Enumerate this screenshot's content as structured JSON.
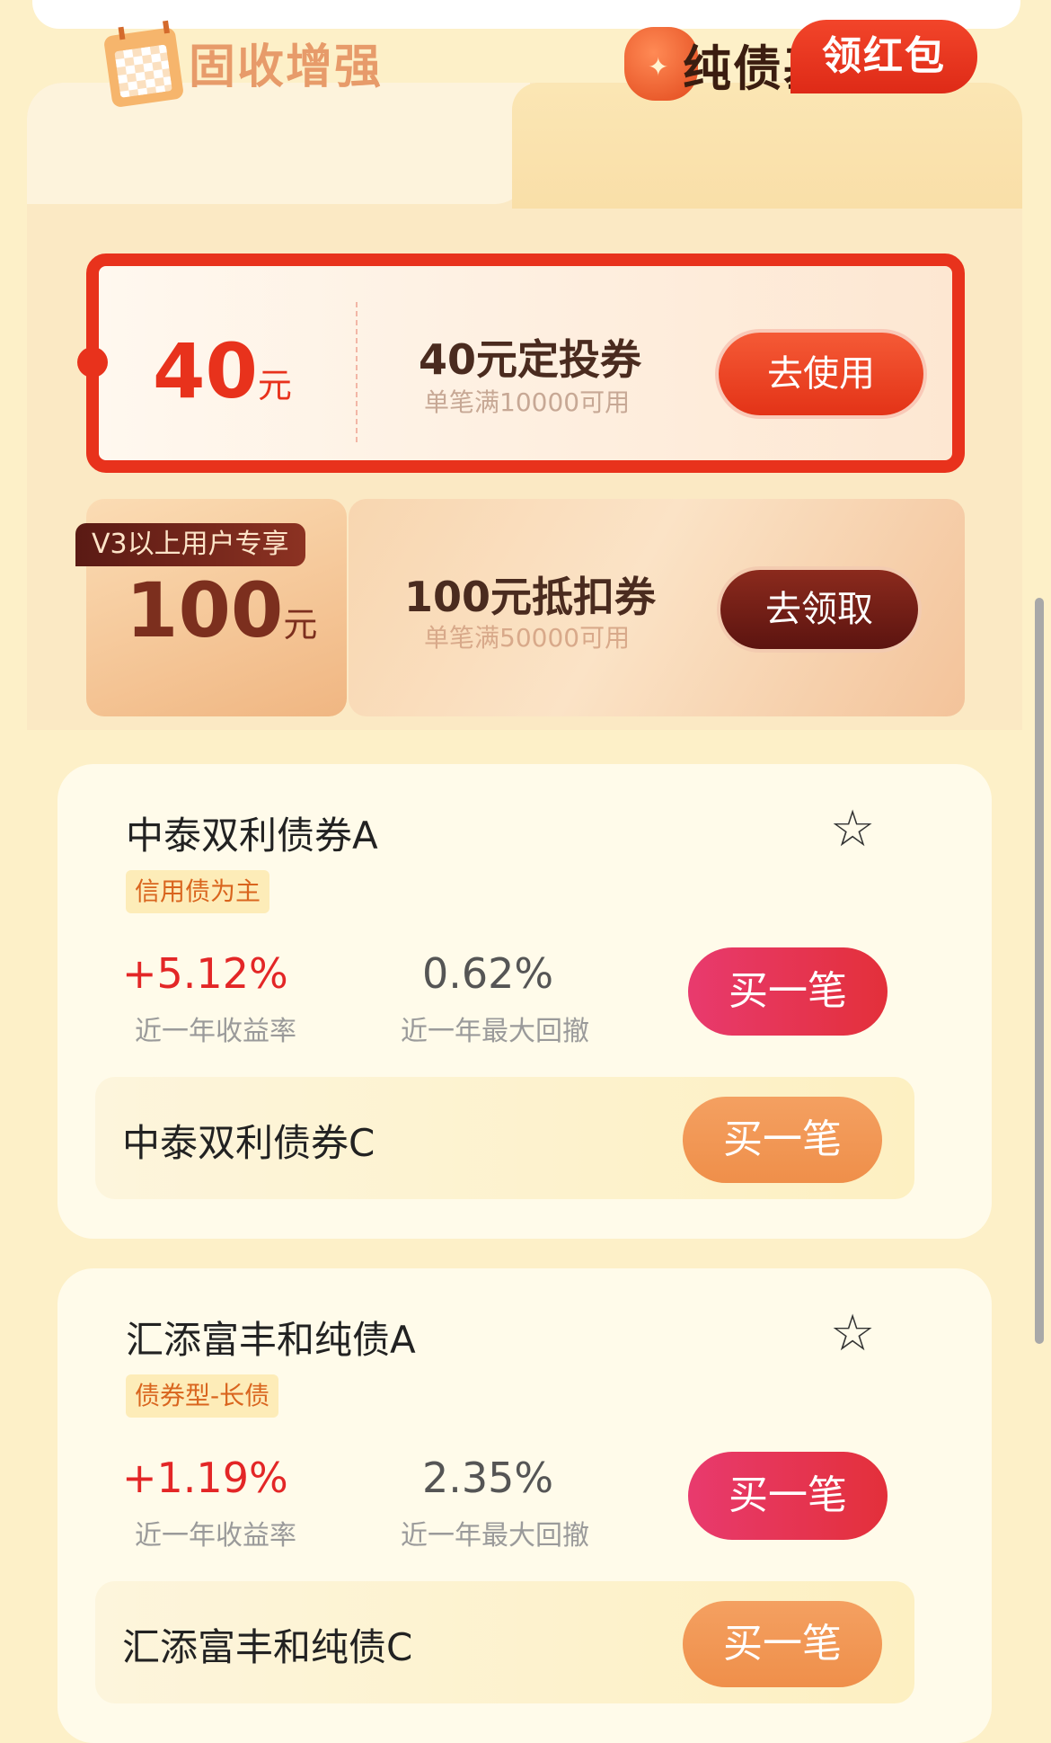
{
  "tabs": {
    "left_label": "固收增强",
    "right_label": "纯债基金",
    "badge": "领红包"
  },
  "coupon1": {
    "amount": "40",
    "unit": "元",
    "title": "40元定投券",
    "condition": "单笔满10000可用",
    "button": "去使用"
  },
  "coupon2": {
    "badge": "V3以上用户专享",
    "amount": "100",
    "unit": "元",
    "title": "100元抵扣券",
    "condition": "单笔满50000可用",
    "button": "去领取"
  },
  "funds": [
    {
      "name": "中泰双利债券A",
      "tag": "信用债为主",
      "rate": "+5.12%",
      "rate_label": "近一年收益率",
      "drawdown": "0.62%",
      "drawdown_label": "近一年最大回撤",
      "buy": "买一笔",
      "c_name": "中泰双利债券C",
      "c_buy": "买一笔"
    },
    {
      "name": "汇添富丰和纯债A",
      "tag": "债券型-长债",
      "rate": "+1.19%",
      "rate_label": "近一年收益率",
      "drawdown": "2.35%",
      "drawdown_label": "近一年最大回撤",
      "buy": "买一笔",
      "c_name": "汇添富丰和纯债C",
      "c_buy": "买一笔"
    }
  ],
  "colors": {
    "accent_red": "#e8321c",
    "background": "#fdf0c8",
    "rate_red": "#e32626"
  }
}
